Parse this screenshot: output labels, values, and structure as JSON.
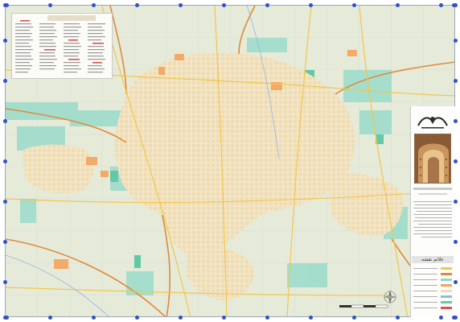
{
  "map": {
    "legend_title": "علائم نقشه",
    "colors": {
      "background": "#e6ead8",
      "built_up": "#eeddb6",
      "major_road": "#f3c64a",
      "highway": "#e08a3a",
      "minor_road": "#ffffff",
      "green_space": "#8fd9c8",
      "industrial": "#f4a35e",
      "grid_border_dot": "#2f53c9",
      "water_channel": "#8fb8e6"
    },
    "icons": [
      "compass-rose-icon",
      "publisher-logo-icon",
      "scale-bar-icon"
    ]
  }
}
